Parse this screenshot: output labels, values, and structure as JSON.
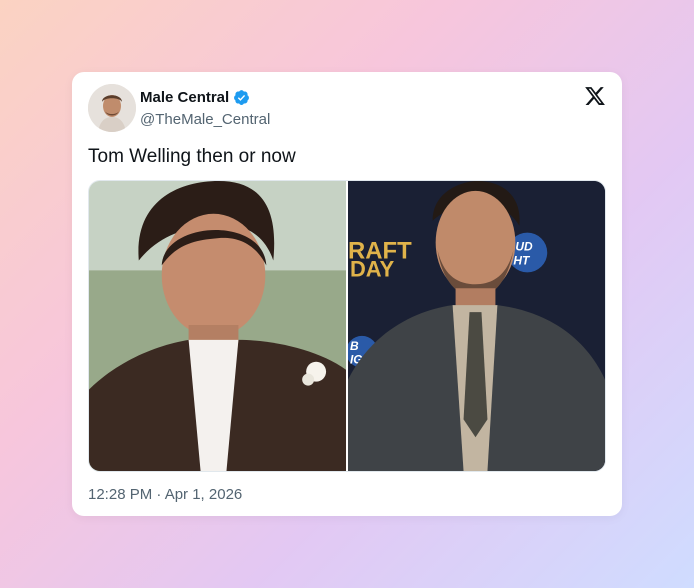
{
  "tweet": {
    "display_name": "Male Central",
    "handle": "@TheMale_Central",
    "text": "Tom Welling then or now",
    "timestamp": "12:28 PM · Apr 1, 2026",
    "verified": true
  },
  "icons": {
    "verified": "verified-badge-icon",
    "platform": "x-logo-icon"
  },
  "media": {
    "images": [
      {
        "name": "then-photo"
      },
      {
        "name": "now-photo",
        "background_text": [
          "RAFT",
          "DAY",
          "UD",
          "HT",
          "B",
          "IG"
        ]
      }
    ]
  },
  "colors": {
    "verified_blue": "#1d9bf0",
    "text_primary": "#0f1419",
    "text_secondary": "#536471"
  }
}
